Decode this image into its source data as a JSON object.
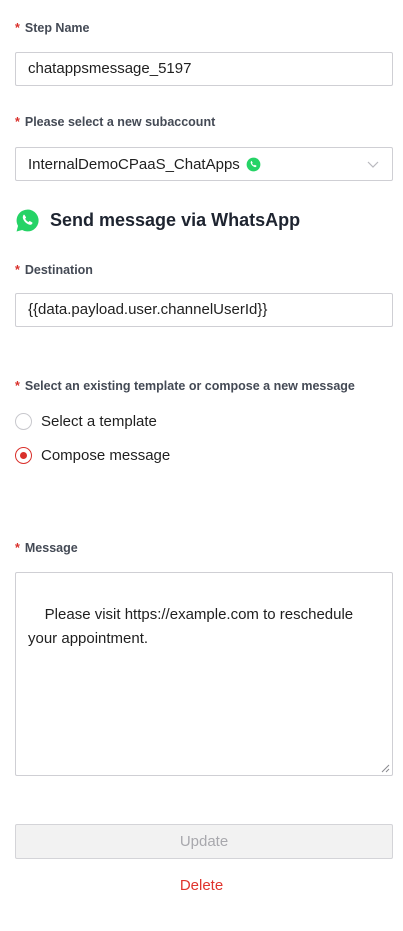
{
  "required_marker": "*",
  "step_name": {
    "label": "Step Name",
    "value": "chatappsmessage_5197"
  },
  "subaccount": {
    "label": "Please select a new subaccount",
    "selected": "InternalDemoCPaaS_ChatApps",
    "icon": "whatsapp-icon"
  },
  "channel": {
    "title": "Send message via WhatsApp",
    "icon": "whatsapp-icon",
    "brand_color": "#25D366"
  },
  "destination": {
    "label": "Destination",
    "value": "{{data.payload.user.channelUserId}}"
  },
  "message_mode": {
    "label": "Select an existing template or compose a new message",
    "options": [
      {
        "label": "Select a template",
        "selected": false
      },
      {
        "label": "Compose message",
        "selected": true
      }
    ]
  },
  "message": {
    "label": "Message",
    "value": "Please visit https://example.com to reschedule your appointment."
  },
  "actions": {
    "update_label": "Update",
    "delete_label": "Delete"
  },
  "colors": {
    "accent": "#D9302B",
    "delete": "#E0342D"
  }
}
